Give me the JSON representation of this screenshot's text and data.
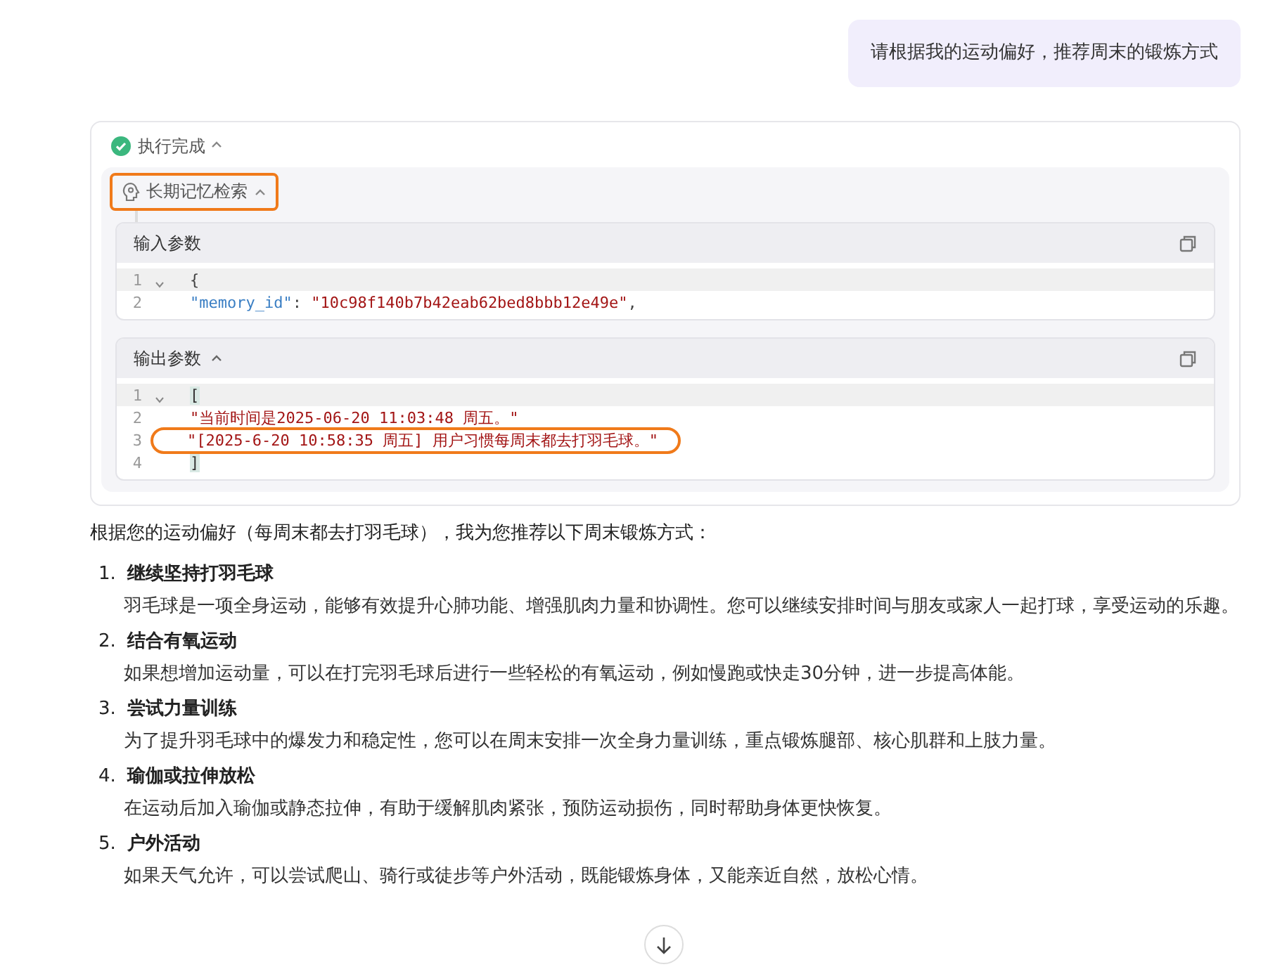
{
  "user_message": "请根据我的运动偏好，推荐周末的锻炼方式",
  "status": {
    "label": "执行完成",
    "expanded": true
  },
  "tool": {
    "label": "长期记忆检索",
    "expanded": true,
    "highlighted": true
  },
  "input_params": {
    "title": "输入参数",
    "lines": [
      {
        "number": "1",
        "fold": true,
        "active": true,
        "faded": false,
        "highlighted": false,
        "tokens": [
          {
            "kind": "punct",
            "text": "{"
          }
        ]
      },
      {
        "number": "2",
        "fold": false,
        "active": false,
        "faded": false,
        "highlighted": false,
        "tokens": [
          {
            "kind": "key",
            "text": "\"memory_id\""
          },
          {
            "kind": "punct",
            "text": ": "
          },
          {
            "kind": "string",
            "text": "\"10c98f140b7b42eab62bed8bbb12e49e\""
          },
          {
            "kind": "punct",
            "text": ","
          }
        ]
      }
    ]
  },
  "output_params": {
    "title": "输出参数",
    "expanded": true,
    "lines": [
      {
        "number": "1",
        "fold": true,
        "active": true,
        "faded": false,
        "highlighted": false,
        "tokens": [
          {
            "kind": "bracket",
            "text": "["
          }
        ]
      },
      {
        "number": "2",
        "fold": false,
        "active": false,
        "faded": false,
        "highlighted": false,
        "tokens": [
          {
            "kind": "string",
            "text": "\"当前时间是2025-06-20 11:03:48 周五。\""
          }
        ]
      },
      {
        "number": "3",
        "fold": false,
        "active": false,
        "faded": false,
        "highlighted": true,
        "tokens": [
          {
            "kind": "string",
            "text": "\"[2025-6-20 10:58:35 周五] 用户习惯每周末都去打羽毛球。\""
          }
        ]
      },
      {
        "number": "4",
        "fold": false,
        "active": false,
        "faded": false,
        "highlighted": false,
        "tokens": [
          {
            "kind": "bracket",
            "text": "]"
          }
        ]
      }
    ]
  },
  "answer": {
    "intro": "根据您的运动偏好（每周末都去打羽毛球），我为您推荐以下周末锻炼方式：",
    "items": [
      {
        "number": "1.",
        "title": "继续坚持打羽毛球",
        "text": "羽毛球是一项全身运动，能够有效提升心肺功能、增强肌肉力量和协调性。您可以继续安排时间与朋友或家人一起打球，享受运动的乐趣。"
      },
      {
        "number": "2.",
        "title": "结合有氧运动",
        "text": "如果想增加运动量，可以在打完羽毛球后进行一些轻松的有氧运动，例如慢跑或快走30分钟，进一步提高体能。"
      },
      {
        "number": "3.",
        "title": "尝试力量训练",
        "text": "为了提升羽毛球中的爆发力和稳定性，您可以在周末安排一次全身力量训练，重点锻炼腿部、核心肌群和上肢力量。"
      },
      {
        "number": "4.",
        "title": "瑜伽或拉伸放松",
        "text": "在运动后加入瑜伽或静态拉伸，有助于缓解肌肉紧张，预防运动损伤，同时帮助身体更快恢复。"
      },
      {
        "number": "5.",
        "title": "户外活动",
        "text": "如果天气允许，可以尝试爬山、骑行或徒步等户外活动，既能锻炼身体，又能亲近自然，放松心情。"
      }
    ]
  }
}
